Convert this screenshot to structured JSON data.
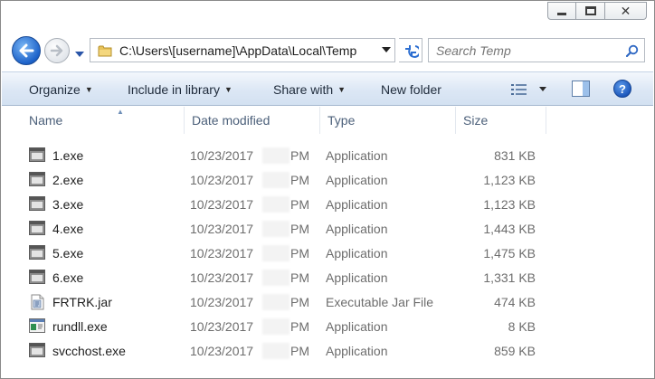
{
  "window": {
    "caption": {
      "minimize": "minimize",
      "maximize": "maximize",
      "close": "✕"
    }
  },
  "nav": {
    "address": "C:\\Users\\[username]\\AppData\\Local\\Temp",
    "search_placeholder": "Search Temp"
  },
  "toolbar": {
    "organize": "Organize",
    "include_in_library": "Include in library",
    "share_with": "Share with",
    "new_folder": "New folder",
    "help": "?"
  },
  "columns": {
    "name": "Name",
    "date_modified": "Date modified",
    "type": "Type",
    "size": "Size"
  },
  "files": [
    {
      "name": "1.exe",
      "date": "10/23/2017",
      "ampm": "PM",
      "type": "Application",
      "size": "831 KB",
      "icon": "exe-icon"
    },
    {
      "name": "2.exe",
      "date": "10/23/2017",
      "ampm": "PM",
      "type": "Application",
      "size": "1,123 KB",
      "icon": "exe-icon"
    },
    {
      "name": "3.exe",
      "date": "10/23/2017",
      "ampm": "PM",
      "type": "Application",
      "size": "1,123 KB",
      "icon": "exe-icon"
    },
    {
      "name": "4.exe",
      "date": "10/23/2017",
      "ampm": "PM",
      "type": "Application",
      "size": "1,443 KB",
      "icon": "exe-icon"
    },
    {
      "name": "5.exe",
      "date": "10/23/2017",
      "ampm": "PM",
      "type": "Application",
      "size": "1,475 KB",
      "icon": "exe-icon"
    },
    {
      "name": "6.exe",
      "date": "10/23/2017",
      "ampm": "PM",
      "type": "Application",
      "size": "1,331 KB",
      "icon": "exe-icon"
    },
    {
      "name": "FRTRK.jar",
      "date": "10/23/2017",
      "ampm": "PM",
      "type": "Executable Jar File",
      "size": "474 KB",
      "icon": "jar-icon"
    },
    {
      "name": "rundll.exe",
      "date": "10/23/2017",
      "ampm": "PM",
      "type": "Application",
      "size": "8 KB",
      "icon": "app-icon"
    },
    {
      "name": "svcchost.exe",
      "date": "10/23/2017",
      "ampm": "PM",
      "type": "Application",
      "size": "859 KB",
      "icon": "exe-icon"
    }
  ]
}
